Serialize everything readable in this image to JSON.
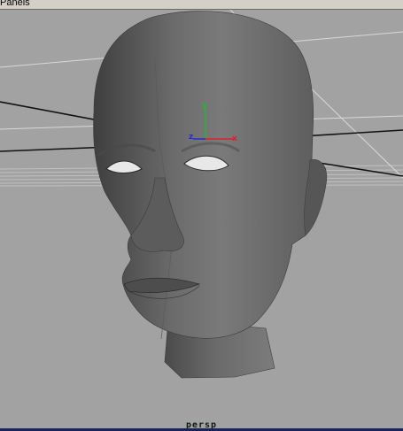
{
  "menu": {
    "panels_label": "Panels"
  },
  "viewport": {
    "camera_label": "persp",
    "axes": {
      "x": "x",
      "y": "y",
      "z": "z"
    },
    "colors": {
      "x_axis": "#e0202a",
      "y_axis": "#22b53a",
      "z_axis": "#2030d0",
      "background": "#a2a2a2"
    }
  }
}
